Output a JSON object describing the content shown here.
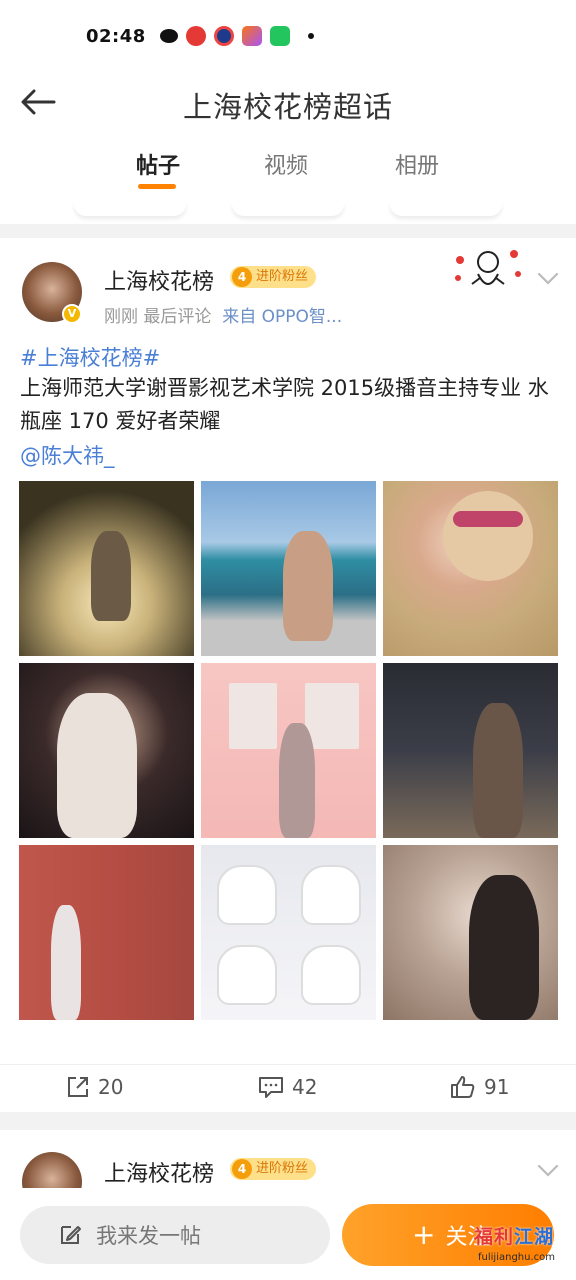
{
  "status_bar": {
    "time": "02:48"
  },
  "header": {
    "title": "上海校花榜超话",
    "back_icon": "arrow-left-icon"
  },
  "tabs": [
    {
      "label": "帖子",
      "active": true
    },
    {
      "label": "视频",
      "active": false
    },
    {
      "label": "相册",
      "active": false
    }
  ],
  "post": {
    "username": "上海校花榜",
    "badge_level": "4",
    "badge_text": "进阶粉丝",
    "meta_time": "刚刚 最后评论",
    "meta_source": "来自 OPPO智...",
    "hashtag": "#上海校花榜#",
    "body": "上海师范大学谢晋影视艺术学院 2015级播音主持专业 水瓶座 170 爱好者荣耀",
    "mention": "@陈大祎_",
    "actions": {
      "repost": "20",
      "comment": "42",
      "like": "91"
    }
  },
  "post2": {
    "username": "上海校花榜",
    "badge_level": "4",
    "badge_text": "进阶粉丝"
  },
  "bottom": {
    "compose_placeholder": "我来发一帖",
    "follow_label": "关注"
  },
  "watermark": {
    "text_a": "福利",
    "text_b": "江湖",
    "url": "fulijianghu.com"
  },
  "colors": {
    "accent": "#ff8200",
    "link": "#4a7fd6",
    "badge": "#f59e0b"
  }
}
